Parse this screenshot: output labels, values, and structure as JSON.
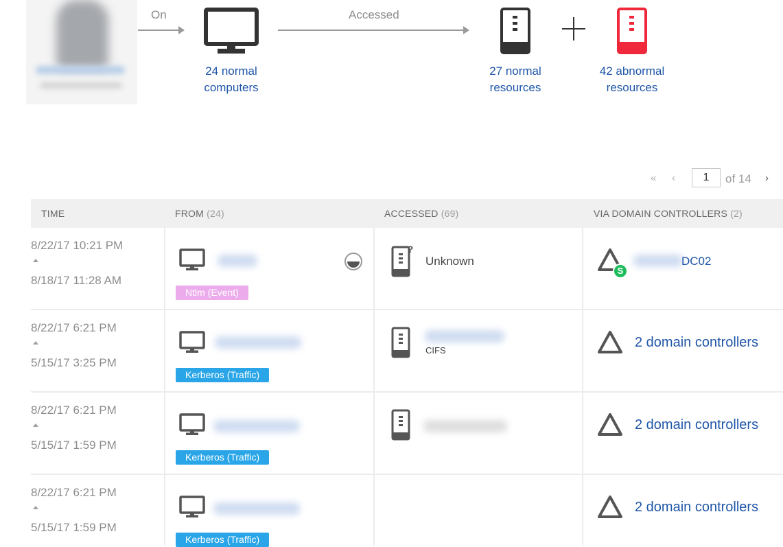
{
  "flow": {
    "on_label": "On",
    "accessed_label": "Accessed",
    "computers": "24 normal\ncomputers",
    "normal_resources": "27 normal\nresources",
    "abnormal_resources": "42 abnormal\nresources",
    "colors": {
      "link": "#1f56a8",
      "abnormal": "#f0283c",
      "icon": "#333333"
    }
  },
  "pager": {
    "current_page": "1",
    "of_text": "of 14"
  },
  "table": {
    "headers": {
      "time": "TIME",
      "from": "FROM",
      "from_count": "(24)",
      "accessed": "ACCESSED",
      "accessed_count": "(69)",
      "via": "VIA DOMAIN CONTROLLERS",
      "via_count": "(2)"
    },
    "rows": [
      {
        "time_end": "8/22/17 10:21 PM",
        "time_start": "8/18/17 11:28 AM",
        "protocol": "Ntlm (Event)",
        "resource": "Unknown",
        "dc_name": "DC02"
      },
      {
        "time_end": "8/22/17 6:21 PM",
        "time_start": "5/15/17 3:25 PM",
        "protocol": "Kerberos (Traffic)",
        "resource_protocol": "CIFS",
        "dc_link": "2 domain controllers"
      },
      {
        "time_end": "8/22/17 6:21 PM",
        "time_start": "5/15/17 1:59 PM",
        "protocol": "Kerberos (Traffic)",
        "dc_link": "2 domain controllers"
      },
      {
        "time_end": "8/22/17 6:21 PM",
        "time_start": "5/15/17 1:59 PM",
        "protocol": "Kerberos (Traffic)",
        "dc_link": "2 domain controllers"
      }
    ]
  },
  "icons": [
    "user-avatar",
    "computer-icon",
    "server-icon",
    "abnormal-server-icon",
    "plus-icon",
    "first-page-icon",
    "prev-page-icon",
    "next-page-icon",
    "partial-status-icon",
    "unknown-server-icon",
    "domain-controller-icon",
    "sensitive-badge-icon"
  ]
}
